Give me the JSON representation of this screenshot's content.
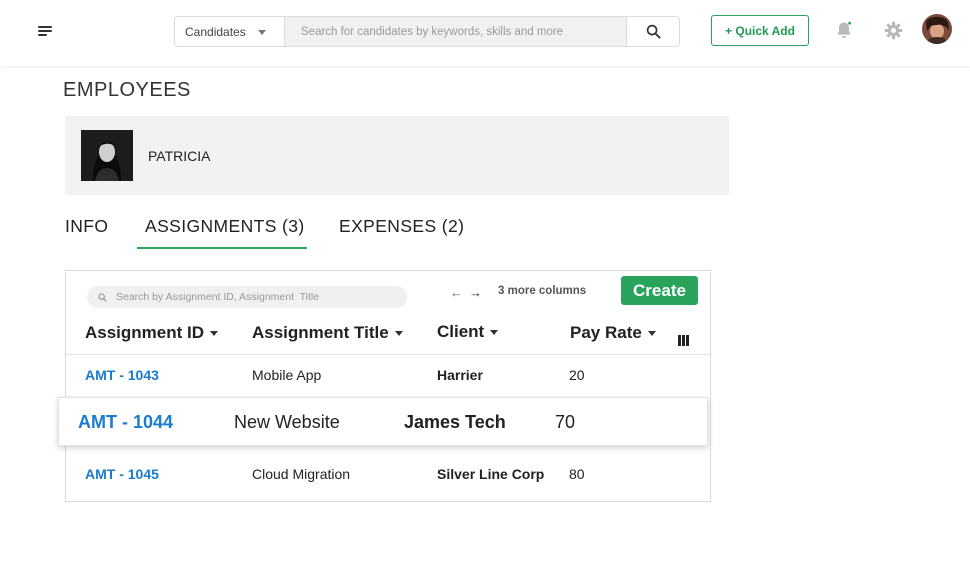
{
  "header": {
    "search_scope": "Candidates",
    "search_placeholder": "Search for candidates by keywords, skills and more",
    "quick_add_label": "+ Quick Add"
  },
  "page": {
    "title": "EMPLOYEES"
  },
  "profile": {
    "name": "PATRICIA"
  },
  "tabs": [
    {
      "label": "INFO",
      "active": false
    },
    {
      "label": "ASSIGNMENTS (3)",
      "active": true
    },
    {
      "label": "EXPENSES (2)",
      "active": false
    }
  ],
  "table": {
    "search_placeholder": "Search by Assignment ID, Assignment  Title",
    "more_columns_label": "3 more columns",
    "create_label": "Create",
    "columns": [
      "Assignment ID",
      "Assignment Title",
      "Client",
      "Pay Rate"
    ],
    "rows": [
      {
        "id": "AMT - 1043",
        "title": "Mobile App",
        "client": "Harrier",
        "pay_rate": "20"
      },
      {
        "id": "AMT - 1044",
        "title": "New Website",
        "client": "James Tech",
        "pay_rate": "70"
      },
      {
        "id": "AMT - 1045",
        "title": "Cloud Migration",
        "client": "Silver Line Corp",
        "pay_rate": "80"
      }
    ]
  },
  "colors": {
    "accent_green": "#2aa45c",
    "link_blue": "#1a7bd0"
  },
  "icons": [
    "menu-icon",
    "chevron-down-icon",
    "search-icon",
    "bell-icon",
    "gear-icon",
    "arrow-left-icon",
    "arrow-right-icon",
    "columns-icon"
  ]
}
